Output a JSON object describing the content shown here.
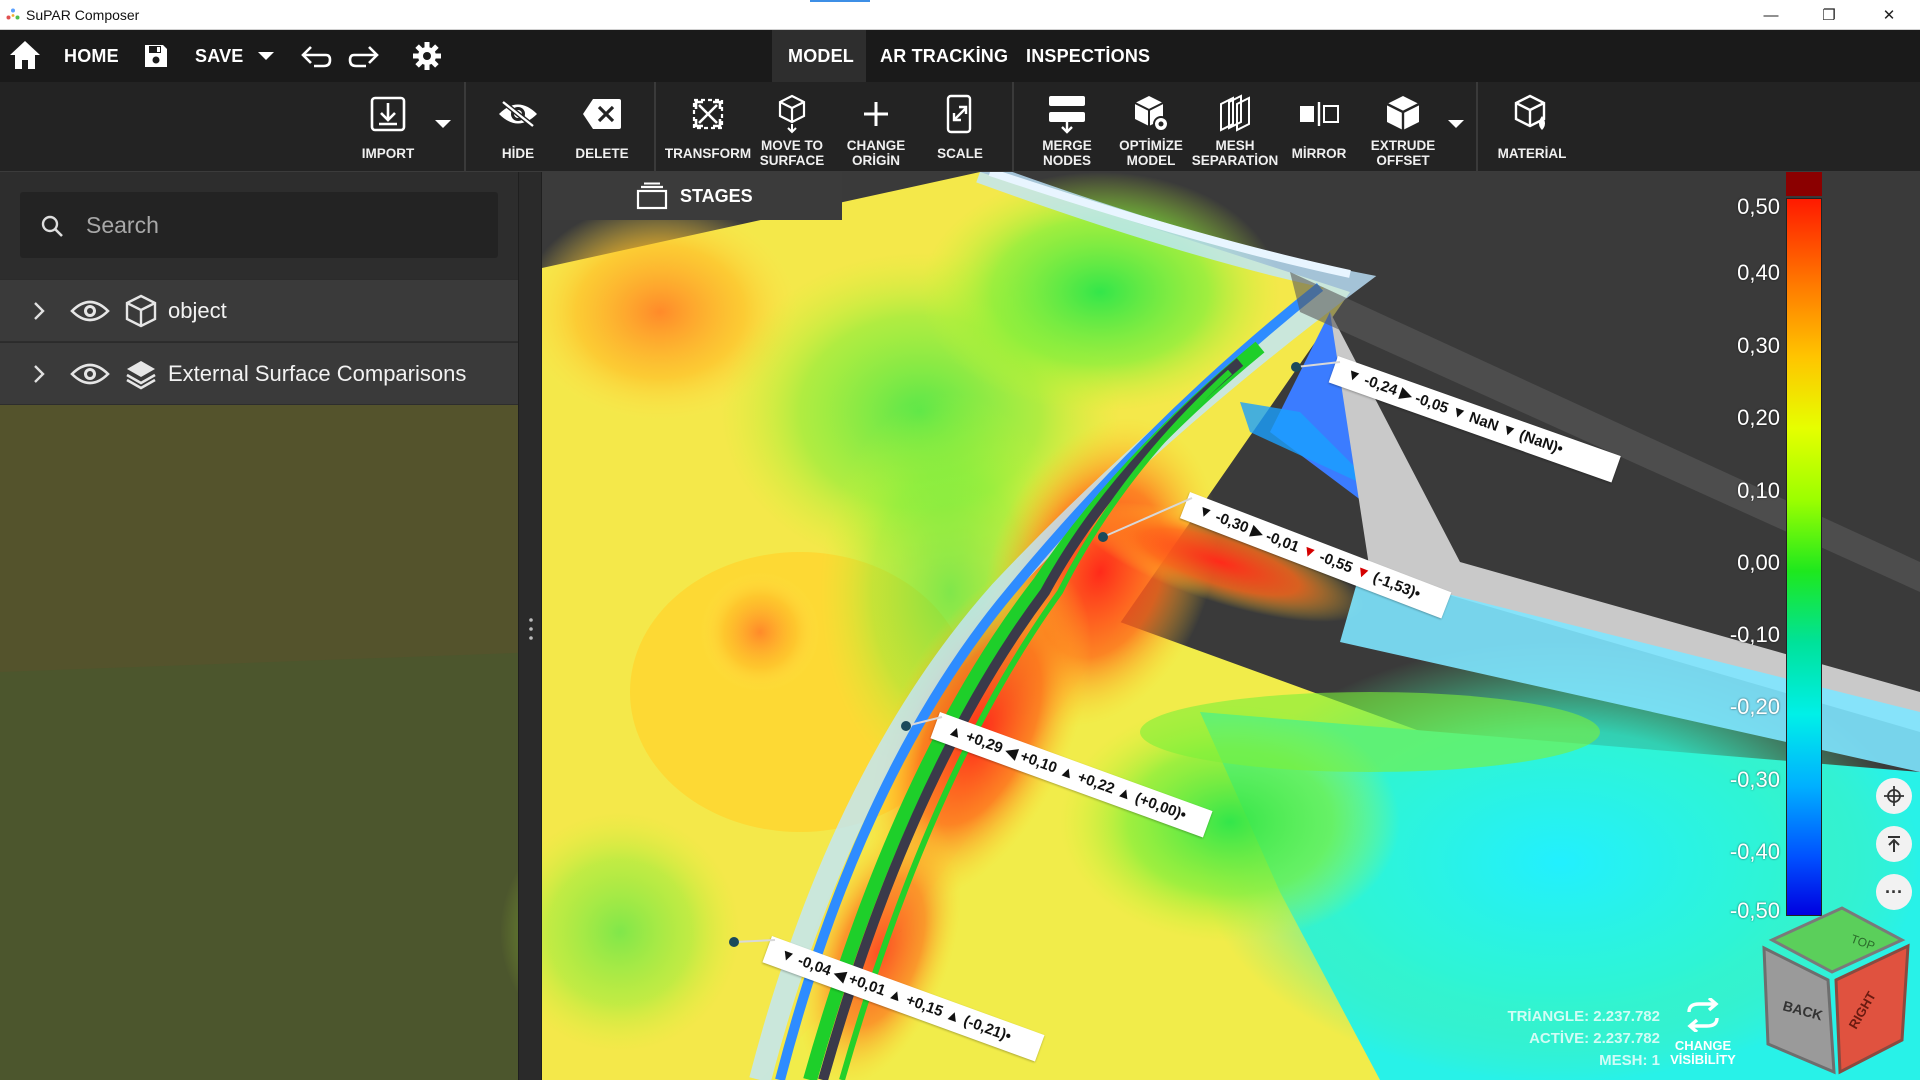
{
  "window": {
    "title": "SuPAR Composer",
    "minimize": "—",
    "maximize": "❐",
    "close": "✕"
  },
  "menu": {
    "home": "HOME",
    "save": "SAVE",
    "tabs": [
      {
        "label": "MODEL",
        "active": true
      },
      {
        "label": "AR TRACKİNG",
        "active": false
      },
      {
        "label": "INSPECTİONS",
        "active": false
      }
    ]
  },
  "toolbar": {
    "import": "IMPORT",
    "hide": "HİDE",
    "delete": "DELETE",
    "transform": "TRANSFORM",
    "move_to_surface": "MOVE TO\nSURFACE",
    "change_origin": "CHANGE\nORİGİN",
    "scale": "SCALE",
    "merge_nodes": "MERGE\nNODES",
    "optimize_model": "OPTİMİZE\nMODEL",
    "mesh_separation": "MESH\nSEPARATİON",
    "mirror": "MİRROR",
    "extrude_offset": "EXTRUDE\nOFFSET",
    "material": "MATERİAL"
  },
  "panel": {
    "search_placeholder": "Search",
    "tree": [
      {
        "label": "object",
        "icon": "cube-icon"
      },
      {
        "label": "External Surface Comparisons",
        "icon": "layers-icon"
      }
    ],
    "stages": "STAGES"
  },
  "scale": {
    "ticks": [
      "0,50",
      "0,40",
      "0,30",
      "0,20",
      "0,10",
      "0,00",
      "-0,10",
      "-0,20",
      "-0,30",
      "-0,40",
      "-0,50"
    ]
  },
  "callouts": [
    {
      "text": "▼ -0,24 ▶ -0,05 ▼ NaN ▼ (NaN)•"
    },
    {
      "pre": "▼ -0,30 ▶ -0,01 ",
      "red1": "▼",
      "mid": " -0,55 ",
      "red2": "▼",
      "post": " (-1,53)•"
    },
    {
      "text": "▲ +0,29 ◀ +0,10 ▲ +0,22 ▲ (+0,00)•"
    },
    {
      "text": "▼ -0,04 ◀ +0,01 ▲ +0,15 ▲ (-0,21)•"
    }
  ],
  "stats": {
    "triangle": "TRİANGLE: 2.237.782",
    "active": "ACTİVE: 2.237.782",
    "mesh": "MESH: 1"
  },
  "change_visibility": "CHANGE\nVİSİBİLİTY",
  "nav_cube": {
    "top": "TOP",
    "back": "BACK",
    "right": "RIGHT"
  }
}
